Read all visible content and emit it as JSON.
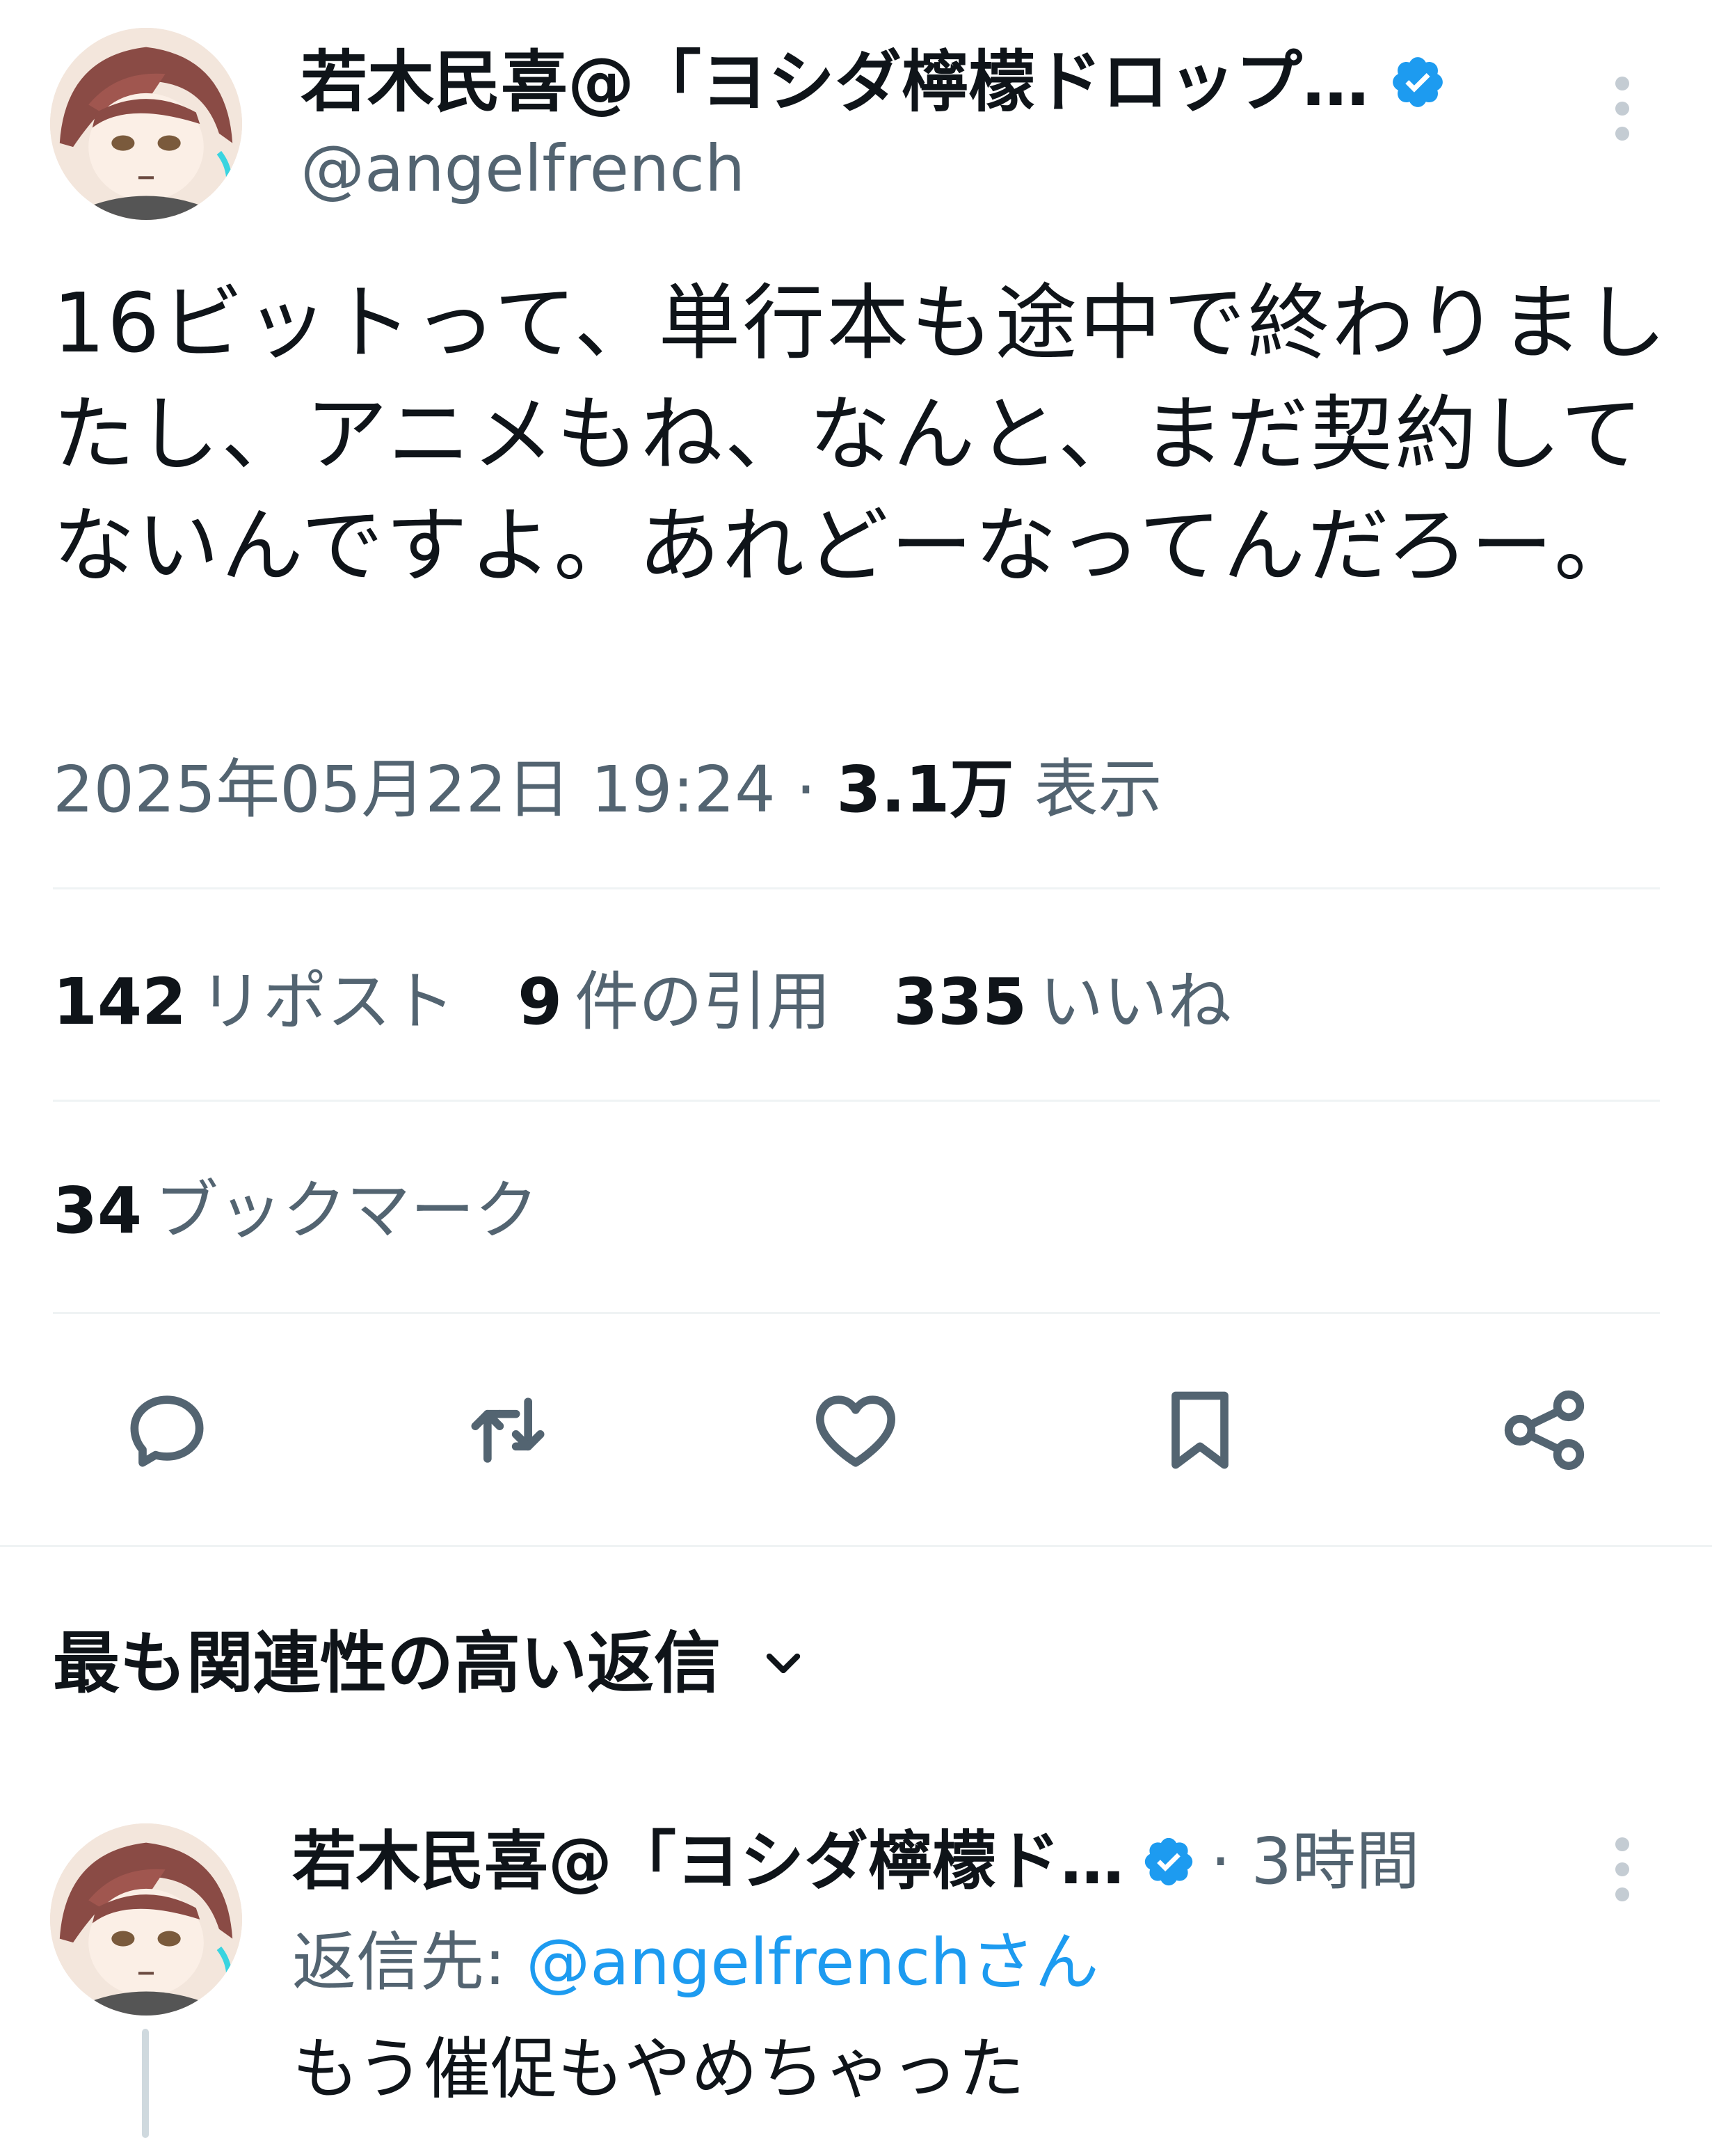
{
  "tweet": {
    "author_name": "若木民喜@「ヨシダ檸檬ドロップ…",
    "handle": "@angelfrench",
    "text": "16ビットって、単行本も途中で終わりましたし、アニメもね、なんと、まだ契約してないんですよ。あれどーなってんだろー。",
    "timestamp": "2025年05月22日 19:24",
    "separator": "·",
    "views_count": "3.1万",
    "views_label": "表示"
  },
  "stats": {
    "reposts_count": "142",
    "reposts_label": "リポスト",
    "quotes_count": "9",
    "quotes_label": "件の引用",
    "likes_count": "335",
    "likes_label": "いいね",
    "bookmarks_count": "34",
    "bookmarks_label": "ブックマーク"
  },
  "actions": [
    "reply-icon",
    "repost-icon",
    "like-icon",
    "bookmark-icon",
    "share-icon"
  ],
  "replies": {
    "sort_label": "最も関連性の高い返信",
    "items": [
      {
        "author_name": "若木民喜@「ヨシダ檸檬ド…",
        "time": "· 3時間",
        "reply_to_label": "返信先:",
        "reply_to_handle": "@angelfrenchさん",
        "text": "もう催促もやめちゃった"
      }
    ]
  },
  "colors": {
    "text": "#0f1419",
    "secondary": "#536471",
    "accent": "#1d9bf0",
    "divider": "#eff3f4"
  }
}
